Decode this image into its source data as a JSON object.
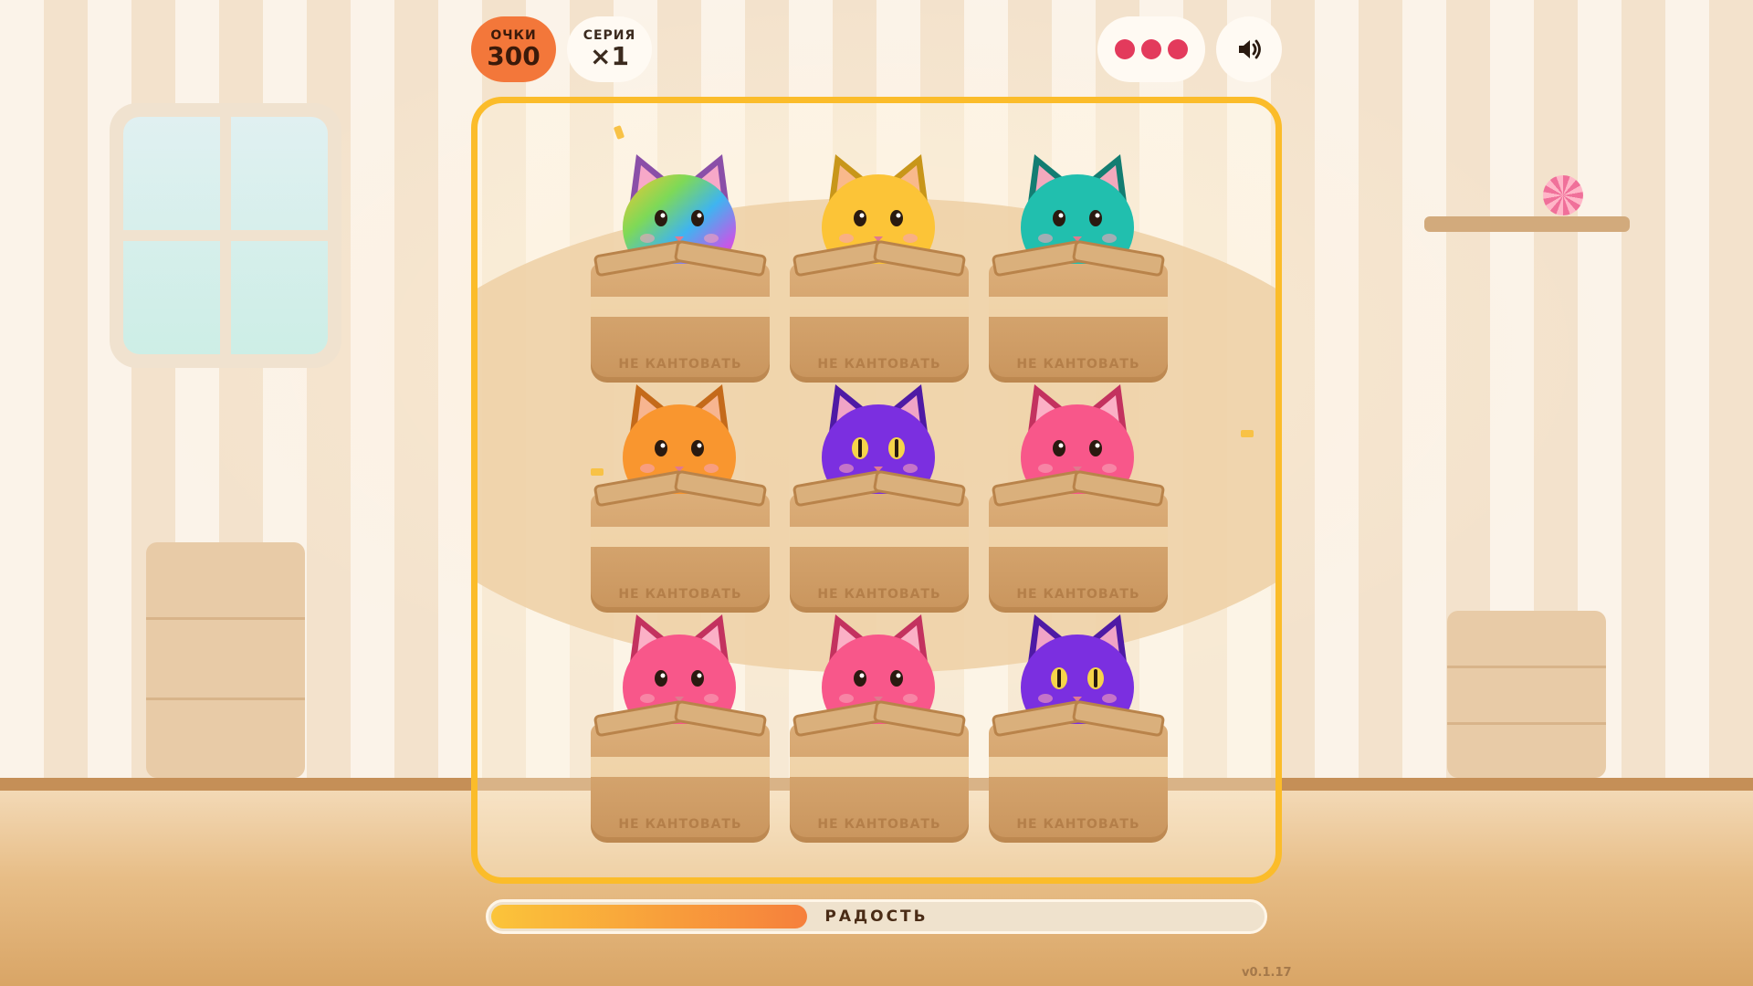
{
  "hud": {
    "score_label": "ОЧКИ",
    "score_value": "300",
    "streak_label": "СЕРИЯ",
    "streak_value": "×1",
    "lives": 3,
    "sound_icon": "speaker-icon"
  },
  "colors": {
    "score_pill": "#f3773a",
    "board_border": "#fbbc2a",
    "life": "#e33a5c"
  },
  "board": {
    "box_label": "НЕ КАНТОВАТЬ",
    "cells": [
      {
        "row": 1,
        "col": 1,
        "cat": "rainbow"
      },
      {
        "row": 1,
        "col": 2,
        "cat": "yellow"
      },
      {
        "row": 1,
        "col": 3,
        "cat": "teal"
      },
      {
        "row": 2,
        "col": 1,
        "cat": "orange"
      },
      {
        "row": 2,
        "col": 2,
        "cat": "purple"
      },
      {
        "row": 2,
        "col": 3,
        "cat": "pink"
      },
      {
        "row": 3,
        "col": 1,
        "cat": "pink"
      },
      {
        "row": 3,
        "col": 2,
        "cat": "pink"
      },
      {
        "row": 3,
        "col": 3,
        "cat": "purple"
      }
    ]
  },
  "joy": {
    "label": "РАДОСТЬ",
    "level": 0.41
  },
  "version": "v0.1.17"
}
